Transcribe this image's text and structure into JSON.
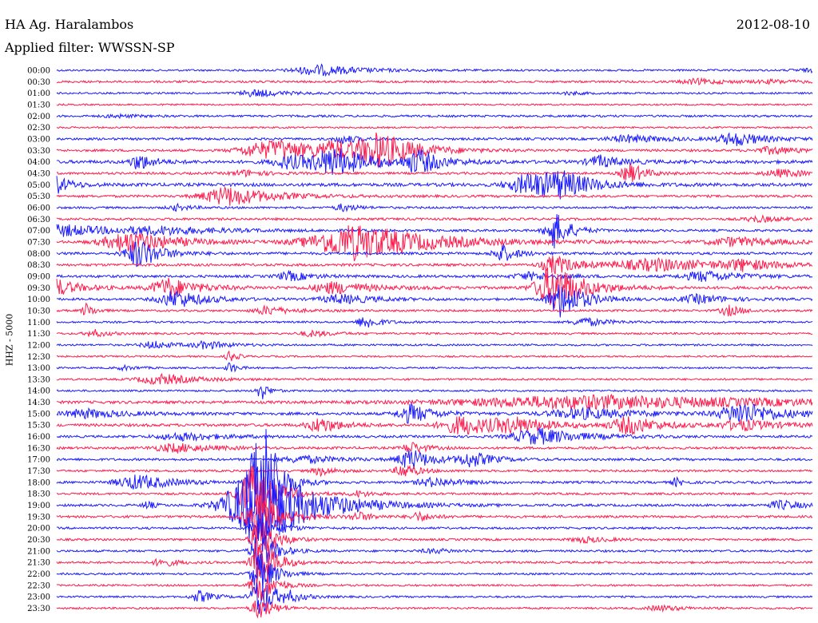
{
  "header": {
    "station": "HA Ag. Haralambos",
    "date": "2012-08-10",
    "filter": "Applied filter: WWSSN-SP"
  },
  "colors": {
    "even": "#1a1aff",
    "odd": "#ff1a4b"
  },
  "chart_data": {
    "type": "line",
    "ylabel": "HHZ - 5000",
    "trace_length_minutes": 30,
    "traces": [
      {
        "label": "00:00",
        "color": "blue",
        "noise": 0.4,
        "events": [
          [
            35,
            6,
            0.7
          ],
          [
            100,
            2,
            0.15
          ],
          [
            98,
            2,
            0.12
          ]
        ]
      },
      {
        "label": "00:30",
        "color": "red",
        "noise": 0.5,
        "events": [
          [
            85,
            4,
            0.35
          ],
          [
            95,
            4,
            0.2
          ]
        ]
      },
      {
        "label": "01:00",
        "color": "blue",
        "noise": 0.4,
        "events": [
          [
            26,
            3,
            0.2
          ],
          [
            27,
            4,
            0.3
          ],
          [
            68,
            2,
            0.2
          ]
        ]
      },
      {
        "label": "01:30",
        "color": "red",
        "noise": 0.3,
        "events": []
      },
      {
        "label": "02:00",
        "color": "blue",
        "noise": 0.5,
        "events": [
          [
            8,
            3,
            0.2
          ]
        ]
      },
      {
        "label": "02:30",
        "color": "red",
        "noise": 0.3,
        "events": []
      },
      {
        "label": "03:00",
        "color": "blue",
        "noise": 0.6,
        "events": [
          [
            38,
            2,
            0.6
          ],
          [
            76,
            5,
            0.5
          ],
          [
            90,
            4,
            0.9
          ]
        ]
      },
      {
        "label": "03:30",
        "color": "red",
        "noise": 0.6,
        "events": [
          [
            26,
            4,
            0.6
          ],
          [
            30,
            6,
            1.2
          ],
          [
            37,
            4,
            1.0
          ],
          [
            43,
            5,
            2.2
          ],
          [
            95,
            4,
            0.5
          ]
        ]
      },
      {
        "label": "04:00",
        "color": "blue",
        "noise": 1.0,
        "events": [
          [
            11,
            2,
            1.1
          ],
          [
            31,
            4,
            0.9
          ],
          [
            37,
            5,
            1.8
          ],
          [
            48,
            3,
            1.6
          ],
          [
            72,
            3,
            0.8
          ]
        ]
      },
      {
        "label": "04:30",
        "color": "red",
        "noise": 0.6,
        "events": [
          [
            25,
            3,
            0.4
          ],
          [
            76,
            2,
            1.4
          ],
          [
            96,
            4,
            0.5
          ]
        ]
      },
      {
        "label": "05:00",
        "color": "blue",
        "noise": 1.0,
        "events": [
          [
            0,
            2,
            1.2
          ],
          [
            63,
            5,
            1.6
          ],
          [
            67,
            4,
            1.3
          ]
        ]
      },
      {
        "label": "05:30",
        "color": "red",
        "noise": 0.6,
        "events": [
          [
            23,
            6,
            1.3
          ]
        ]
      },
      {
        "label": "06:00",
        "color": "blue",
        "noise": 0.5,
        "events": [
          [
            16,
            2,
            0.4
          ],
          [
            38,
            2,
            0.5
          ]
        ]
      },
      {
        "label": "06:30",
        "color": "red",
        "noise": 0.6,
        "events": [
          [
            93,
            3,
            0.4
          ]
        ]
      },
      {
        "label": "07:00",
        "color": "blue",
        "noise": 0.6,
        "events": [
          [
            1,
            7,
            0.8
          ],
          [
            14,
            8,
            0.5
          ],
          [
            66,
            2,
            2.6
          ]
        ]
      },
      {
        "label": "07:30",
        "color": "red",
        "noise": 0.7,
        "events": [
          [
            10,
            6,
            1.5
          ],
          [
            40,
            10,
            2.5
          ],
          [
            90,
            6,
            0.6
          ]
        ]
      },
      {
        "label": "08:00",
        "color": "blue",
        "noise": 0.7,
        "events": [
          [
            11,
            3,
            2.0
          ],
          [
            59,
            2,
            1.2
          ]
        ]
      },
      {
        "label": "08:30",
        "color": "red",
        "noise": 0.7,
        "events": [
          [
            66,
            3,
            1.3
          ],
          [
            80,
            10,
            0.8
          ],
          [
            91,
            4,
            0.6
          ]
        ]
      },
      {
        "label": "09:00",
        "color": "blue",
        "noise": 0.7,
        "events": [
          [
            31,
            3,
            0.6
          ],
          [
            63,
            4,
            0.5
          ],
          [
            86,
            5,
            0.7
          ]
        ]
      },
      {
        "label": "09:30",
        "color": "red",
        "noise": 0.8,
        "events": [
          [
            0,
            3,
            1.2
          ],
          [
            15,
            4,
            1.3
          ],
          [
            37,
            5,
            0.8
          ],
          [
            66,
            4,
            3.2
          ]
        ]
      },
      {
        "label": "10:00",
        "color": "blue",
        "noise": 0.6,
        "events": [
          [
            16,
            4,
            1.2
          ],
          [
            38,
            5,
            0.6
          ],
          [
            67,
            3,
            2.6
          ],
          [
            85,
            4,
            0.6
          ]
        ]
      },
      {
        "label": "10:30",
        "color": "red",
        "noise": 0.5,
        "events": [
          [
            4,
            1,
            1.0
          ],
          [
            28,
            3,
            0.6
          ],
          [
            89,
            2,
            0.7
          ]
        ]
      },
      {
        "label": "11:00",
        "color": "blue",
        "noise": 0.4,
        "events": [
          [
            41,
            2,
            0.9
          ],
          [
            70,
            3,
            0.6
          ]
        ]
      },
      {
        "label": "11:30",
        "color": "red",
        "noise": 0.4,
        "events": [
          [
            5,
            2,
            0.5
          ],
          [
            34,
            3,
            0.4
          ]
        ]
      },
      {
        "label": "12:00",
        "color": "blue",
        "noise": 0.4,
        "events": [
          [
            13,
            3,
            0.5
          ],
          [
            20,
            3,
            0.5
          ]
        ]
      },
      {
        "label": "12:30",
        "color": "red",
        "noise": 0.3,
        "events": [
          [
            23,
            1,
            0.8
          ]
        ]
      },
      {
        "label": "13:00",
        "color": "blue",
        "noise": 0.3,
        "events": [
          [
            9,
            2,
            0.3
          ],
          [
            23,
            1,
            0.8
          ]
        ]
      },
      {
        "label": "13:30",
        "color": "red",
        "noise": 0.4,
        "events": [
          [
            14,
            5,
            0.7
          ]
        ]
      },
      {
        "label": "14:00",
        "color": "blue",
        "noise": 0.4,
        "events": [
          [
            27,
            1,
            1.4
          ]
        ]
      },
      {
        "label": "14:30",
        "color": "red",
        "noise": 0.8,
        "events": [
          [
            72,
            30,
            0.9
          ]
        ]
      },
      {
        "label": "15:00",
        "color": "blue",
        "noise": 0.8,
        "events": [
          [
            4,
            5,
            0.6
          ],
          [
            47,
            3,
            1.3
          ],
          [
            70,
            8,
            0.7
          ],
          [
            91,
            5,
            1.5
          ]
        ]
      },
      {
        "label": "15:30",
        "color": "red",
        "noise": 0.8,
        "events": [
          [
            35,
            3,
            1.0
          ],
          [
            54,
            5,
            1.3
          ],
          [
            61,
            5,
            0.8
          ],
          [
            76,
            4,
            1.2
          ],
          [
            91,
            5,
            0.7
          ]
        ]
      },
      {
        "label": "16:00",
        "color": "blue",
        "noise": 0.6,
        "events": [
          [
            17,
            6,
            0.5
          ],
          [
            64,
            6,
            1.1
          ]
        ]
      },
      {
        "label": "16:30",
        "color": "red",
        "noise": 0.6,
        "events": [
          [
            16,
            5,
            0.6
          ],
          [
            47,
            2,
            0.8
          ]
        ]
      },
      {
        "label": "17:00",
        "color": "blue",
        "noise": 0.6,
        "events": [
          [
            33,
            5,
            0.5
          ],
          [
            47,
            3,
            1.4
          ],
          [
            55,
            3,
            1.0
          ]
        ]
      },
      {
        "label": "17:30",
        "color": "red",
        "noise": 0.5,
        "events": [
          [
            35,
            2,
            0.6
          ],
          [
            46,
            2,
            1.0
          ]
        ]
      },
      {
        "label": "18:00",
        "color": "blue",
        "noise": 0.6,
        "events": [
          [
            11,
            5,
            1.0
          ],
          [
            27,
            2,
            12.0
          ],
          [
            50,
            4,
            0.6
          ],
          [
            82,
            1,
            0.6
          ]
        ]
      },
      {
        "label": "18:30",
        "color": "red",
        "noise": 0.5,
        "events": [
          [
            26,
            3,
            4.0
          ],
          [
            40,
            2,
            0.4
          ]
        ]
      },
      {
        "label": "19:00",
        "color": "blue",
        "noise": 0.6,
        "events": [
          [
            27,
            7,
            6.0
          ],
          [
            12,
            1,
            0.6
          ],
          [
            96,
            3,
            0.6
          ]
        ]
      },
      {
        "label": "19:30",
        "color": "red",
        "noise": 0.6,
        "events": [
          [
            27,
            3,
            3.5
          ],
          [
            40,
            2,
            0.6
          ],
          [
            48,
            2,
            0.6
          ]
        ]
      },
      {
        "label": "20:00",
        "color": "blue",
        "noise": 0.5,
        "events": [
          [
            27,
            2,
            3.0
          ]
        ]
      },
      {
        "label": "20:30",
        "color": "red",
        "noise": 0.5,
        "events": [
          [
            27,
            2,
            3.5
          ],
          [
            70,
            3,
            0.4
          ]
        ]
      },
      {
        "label": "21:00",
        "color": "blue",
        "noise": 0.5,
        "events": [
          [
            27,
            2,
            3.0
          ],
          [
            50,
            3,
            0.3
          ]
        ]
      },
      {
        "label": "21:30",
        "color": "red",
        "noise": 0.5,
        "events": [
          [
            14,
            2,
            0.6
          ],
          [
            27,
            2,
            4.0
          ]
        ]
      },
      {
        "label": "22:00",
        "color": "blue",
        "noise": 0.4,
        "events": [
          [
            27,
            2,
            3.0
          ]
        ]
      },
      {
        "label": "22:30",
        "color": "red",
        "noise": 0.4,
        "events": [
          [
            27,
            2,
            2.5
          ]
        ]
      },
      {
        "label": "23:00",
        "color": "blue",
        "noise": 0.4,
        "events": [
          [
            19,
            2,
            0.8
          ],
          [
            27,
            2,
            3.0
          ],
          [
            31,
            2,
            0.5
          ]
        ]
      },
      {
        "label": "23:30",
        "color": "red",
        "noise": 0.4,
        "events": [
          [
            27,
            2,
            1.5
          ],
          [
            80,
            3,
            0.4
          ]
        ]
      }
    ]
  }
}
